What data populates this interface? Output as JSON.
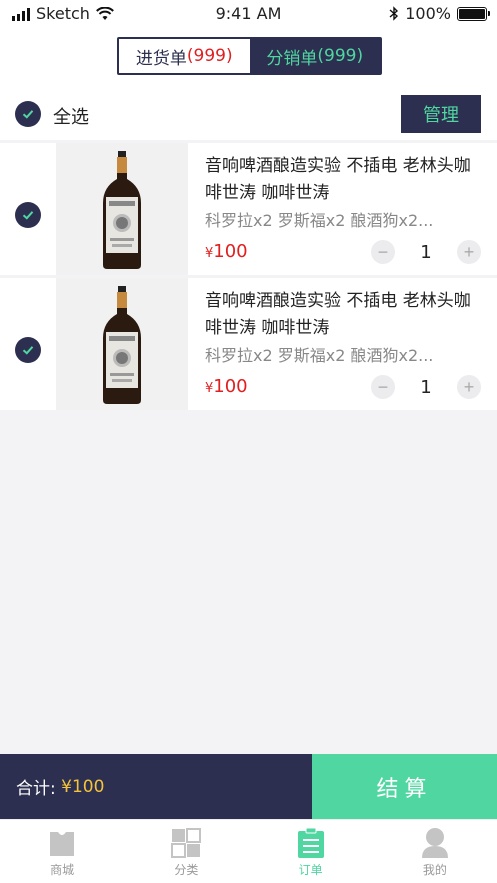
{
  "status_bar": {
    "carrier": "Sketch",
    "time": "9:41 AM",
    "battery": "100%"
  },
  "header": {
    "tabs": [
      {
        "label": "进货单",
        "count": "(999)"
      },
      {
        "label": "分销单",
        "count": "(999)"
      }
    ]
  },
  "select_all": {
    "label": "全选",
    "manage_label": "管理"
  },
  "items": [
    {
      "title": "音响啤酒酿造实验 不插电 老林头咖啡世涛   咖啡世涛",
      "spec": "科罗拉x2  罗斯福x2  酿酒狗x2...",
      "currency": "¥",
      "price": "100",
      "qty": "1"
    },
    {
      "title": "音响啤酒酿造实验 不插电 老林头咖啡世涛   咖啡世涛",
      "spec": "科罗拉x2  罗斯福x2  酿酒狗x2...",
      "currency": "¥",
      "price": "100",
      "qty": "1"
    }
  ],
  "checkout": {
    "total_label": "合计:",
    "total_amount": "¥100",
    "pay_label": "结算"
  },
  "tabbar": [
    {
      "label": "商城",
      "icon": "shopping-bag-icon"
    },
    {
      "label": "分类",
      "icon": "category-grid-icon"
    },
    {
      "label": "订单",
      "icon": "order-list-icon"
    },
    {
      "label": "我的",
      "icon": "profile-icon"
    }
  ],
  "colors": {
    "navy": "#2c2f4f",
    "green": "#4fd6a1",
    "red": "#e02020",
    "gold": "#f5c33b"
  }
}
